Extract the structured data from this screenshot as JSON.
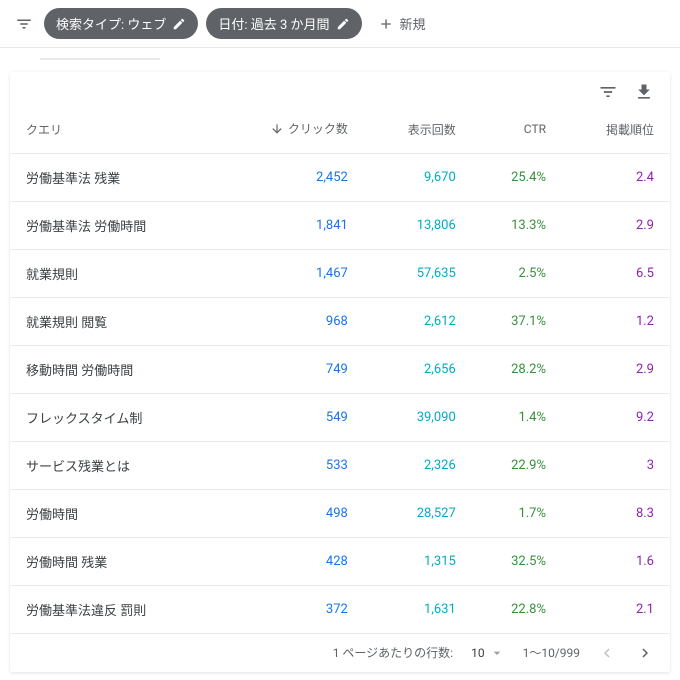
{
  "toolbar": {
    "chip1": "検索タイプ: ウェブ",
    "chip2": "日付: 過去 3 か月間",
    "new_label": "新規"
  },
  "headers": {
    "query": "クエリ",
    "clicks": "クリック数",
    "impressions": "表示回数",
    "ctr": "CTR",
    "position": "掲載順位"
  },
  "rows": [
    {
      "q": "労働基準法 残業",
      "c": "2,452",
      "i": "9,670",
      "r": "25.4%",
      "p": "2.4"
    },
    {
      "q": "労働基準法 労働時間",
      "c": "1,841",
      "i": "13,806",
      "r": "13.3%",
      "p": "2.9"
    },
    {
      "q": "就業規則",
      "c": "1,467",
      "i": "57,635",
      "r": "2.5%",
      "p": "6.5"
    },
    {
      "q": "就業規則 閲覧",
      "c": "968",
      "i": "2,612",
      "r": "37.1%",
      "p": "1.2"
    },
    {
      "q": "移動時間 労働時間",
      "c": "749",
      "i": "2,656",
      "r": "28.2%",
      "p": "2.9"
    },
    {
      "q": "フレックスタイム制",
      "c": "549",
      "i": "39,090",
      "r": "1.4%",
      "p": "9.2"
    },
    {
      "q": "サービス残業とは",
      "c": "533",
      "i": "2,326",
      "r": "22.9%",
      "p": "3"
    },
    {
      "q": "労働時間",
      "c": "498",
      "i": "28,527",
      "r": "1.7%",
      "p": "8.3"
    },
    {
      "q": "労働時間 残業",
      "c": "428",
      "i": "1,315",
      "r": "32.5%",
      "p": "1.6"
    },
    {
      "q": "労働基準法違反 罰則",
      "c": "372",
      "i": "1,631",
      "r": "22.8%",
      "p": "2.1"
    }
  ],
  "pager": {
    "rows_label": "1 ページあたりの行数:",
    "rows_value": "10",
    "range": "1～10/999"
  }
}
